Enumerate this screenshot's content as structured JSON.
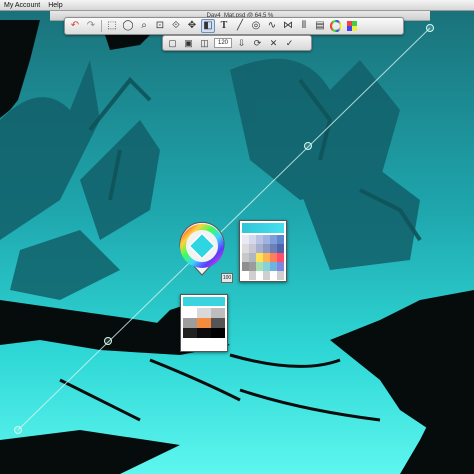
{
  "menubar": {
    "items": [
      "My Account",
      "Help"
    ]
  },
  "window": {
    "title": "Day4_Mat.psd @ 64.5 %"
  },
  "toolbar": {
    "tools": [
      {
        "name": "undo-icon",
        "glyph": "↶"
      },
      {
        "name": "redo-icon",
        "glyph": "↷"
      },
      {
        "name": "selection-icon",
        "glyph": "⬚"
      },
      {
        "name": "lasso-icon",
        "glyph": "◯"
      },
      {
        "name": "zoom-icon",
        "glyph": "⌕"
      },
      {
        "name": "crop-icon",
        "glyph": "⊡"
      },
      {
        "name": "transform-icon",
        "glyph": "⟐"
      },
      {
        "name": "move-icon",
        "glyph": "✥"
      },
      {
        "name": "fill-icon",
        "glyph": "◧"
      },
      {
        "name": "text-icon",
        "glyph": "T"
      },
      {
        "name": "ruler-icon",
        "glyph": "╱"
      },
      {
        "name": "ellipse-guide-icon",
        "glyph": "◎"
      },
      {
        "name": "curve-icon",
        "glyph": "∿"
      },
      {
        "name": "perspective-icon",
        "glyph": "⋈"
      },
      {
        "name": "symmetry-icon",
        "glyph": "⫴"
      },
      {
        "name": "layers-icon",
        "glyph": "▤"
      },
      {
        "name": "color-wheel-icon",
        "glyph": "◉"
      },
      {
        "name": "brushes-icon",
        "glyph": "▦"
      }
    ]
  },
  "subtoolbar": {
    "items": [
      {
        "name": "transform-mode-icon",
        "glyph": "▢"
      },
      {
        "name": "transform-scale-icon",
        "glyph": "▣"
      },
      {
        "name": "transform-distort-icon",
        "glyph": "◫"
      },
      {
        "name": "rotation-value",
        "glyph": ""
      },
      {
        "name": "flip-icon",
        "glyph": "⇩"
      },
      {
        "name": "rotate-icon",
        "glyph": "⟳"
      },
      {
        "name": "cancel-icon",
        "glyph": "✕"
      },
      {
        "name": "confirm-icon",
        "glyph": "✓"
      }
    ],
    "field_value": "120"
  },
  "puck": {
    "magnifier_label": "100"
  },
  "colors": {
    "canvas_bg_top": "#1a7f86",
    "canvas_bg_mid": "#24c3c8",
    "canvas_bg_bottom": "#4ef2ee",
    "ink": "#060b0c",
    "current_color": "#2fd6e2"
  }
}
